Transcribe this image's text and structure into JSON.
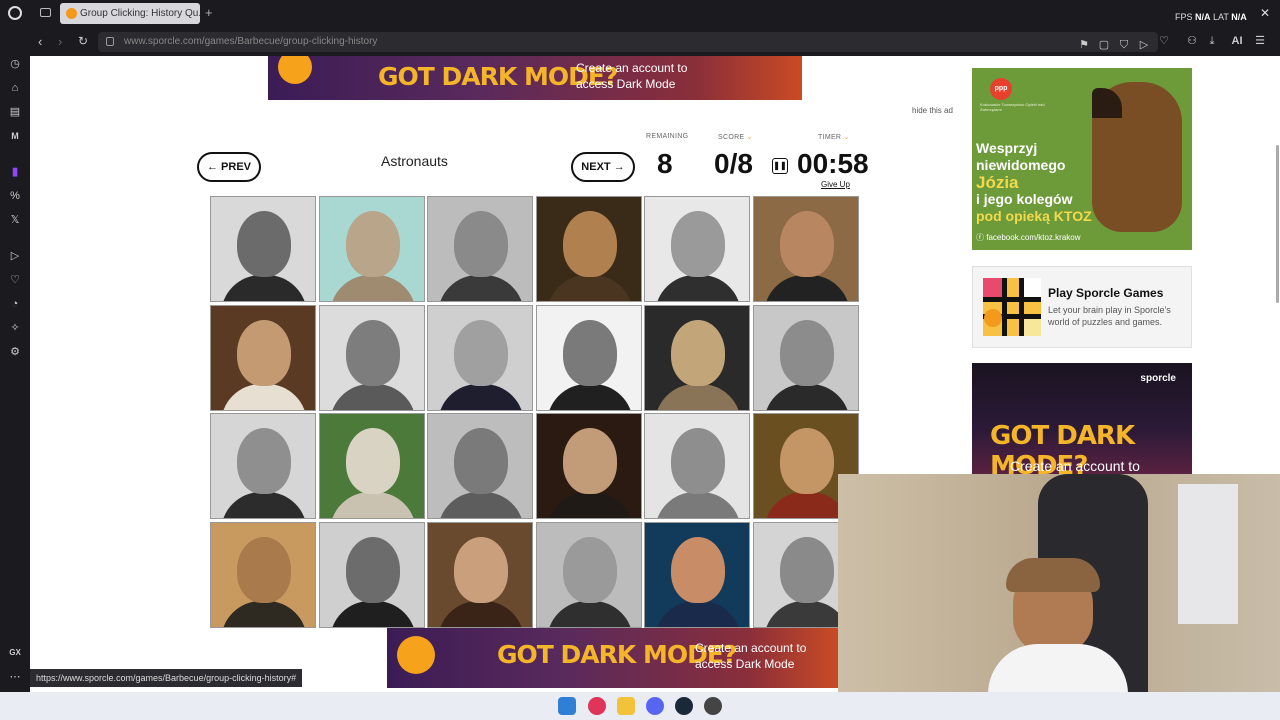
{
  "browser": {
    "tab_title": "Group Clicking: History Qu...",
    "url": "www.sporcle.com/games/Barbecue/group-clicking-history",
    "fps_label": "FPS",
    "fps_value": "N/A",
    "lat_label": "LAT",
    "lat_value": "N/A",
    "ai_label": "AI",
    "gx_label": "GX",
    "status_url": "https://www.sporcle.com/games/Barbecue/group-clicking-history#"
  },
  "ads": {
    "top": {
      "headline": "GOT DARK MODE?",
      "cta": "Create an account to access Dark Mode"
    },
    "bottom": {
      "headline": "GOT DARK MODE?",
      "cta": "Create an account to access Dark Mode"
    },
    "hide_ad": "hide this ad",
    "dog": {
      "line1": "Wesprzyj",
      "line2": "niewidomego",
      "line3": "Józia",
      "line4": "i jego kolegów",
      "line5": "pod opieką KTOZ",
      "facebook": "facebook.com/ktoz.krakow",
      "logo": "ppp",
      "subtext": "Krakowskie Towarzystwo Opieki nad Zwierzętami"
    },
    "sporcle_card": {
      "title": "Play Sporcle Games",
      "description": "Let your brain play in Sporcle's world of puzzles and games."
    },
    "side_dark": {
      "brand": "sporcle",
      "headline": "GOT DARK MODE?",
      "cta": "Create an account to"
    }
  },
  "quiz": {
    "title": "Astronauts",
    "prev_label": "PREV",
    "next_label": "NEXT",
    "remaining_label": "REMAINING",
    "remaining": "8",
    "score_label": "SCORE",
    "score": "0/8",
    "timer_label": "TIMER",
    "timer": "00:58",
    "give_up": "Give Up"
  },
  "grid": {
    "rows": 4,
    "cols": 6,
    "tiles": [
      {
        "bg": "#d9d9d9",
        "face": "#6b6b6b",
        "cloth": "#2a2a2a"
      },
      {
        "bg": "#a9d8d3",
        "face": "#b9a58a",
        "cloth": "#9e8b70"
      },
      {
        "bg": "#bcbcbc",
        "face": "#8a8a8a",
        "cloth": "#3a3a3a"
      },
      {
        "bg": "#3a2a18",
        "face": "#b0804f",
        "cloth": "#4a3520"
      },
      {
        "bg": "#e8e8e8",
        "face": "#9a9a9a",
        "cloth": "#2f2f2f"
      },
      {
        "bg": "#8c6a45",
        "face": "#b88660",
        "cloth": "#222222"
      },
      {
        "bg": "#5a3a22",
        "face": "#c49a72",
        "cloth": "#e6dfd2"
      },
      {
        "bg": "#dcdcdc",
        "face": "#7d7d7d",
        "cloth": "#5a5a5a"
      },
      {
        "bg": "#cfcfcf",
        "face": "#a0a0a0",
        "cloth": "#1e1e2e"
      },
      {
        "bg": "#f2f2f2",
        "face": "#7a7a7a",
        "cloth": "#202020"
      },
      {
        "bg": "#2a2a2a",
        "face": "#c2a67a",
        "cloth": "#8a7457"
      },
      {
        "bg": "#c8c8c8",
        "face": "#8c8c8c",
        "cloth": "#2a2a2a"
      },
      {
        "bg": "#d6d6d6",
        "face": "#8f8f8f",
        "cloth": "#2c2c2c"
      },
      {
        "bg": "#4b7a3a",
        "face": "#d9d3c4",
        "cloth": "#c9c2b0"
      },
      {
        "bg": "#bdbdbd",
        "face": "#7a7a7a",
        "cloth": "#5d5d5d"
      },
      {
        "bg": "#2a1a12",
        "face": "#c29c78",
        "cloth": "#1f1a16"
      },
      {
        "bg": "#e4e4e4",
        "face": "#8e8e8e",
        "cloth": "#7a7a7a"
      },
      {
        "bg": "#6a5020",
        "face": "#c49666",
        "cloth": "#8a2a1a"
      },
      {
        "bg": "#c99a60",
        "face": "#a87a4c",
        "cloth": "#2e2a22"
      },
      {
        "bg": "#cfcfcf",
        "face": "#6c6c6c",
        "cloth": "#1f1f1f"
      },
      {
        "bg": "#6a4a2e",
        "face": "#caa07c",
        "cloth": "#3a2418"
      },
      {
        "bg": "#bcbcbc",
        "face": "#9a9a9a",
        "cloth": "#2f2f2f"
      },
      {
        "bg": "#123a5a",
        "face": "#c88c66",
        "cloth": "#1a2a4a"
      },
      {
        "bg": "#d4d4d4",
        "face": "#8a8a8a",
        "cloth": "#3a3a3a"
      }
    ]
  },
  "colors": {
    "accent": "#e3a32b",
    "chrome": "#1b1b1f"
  }
}
